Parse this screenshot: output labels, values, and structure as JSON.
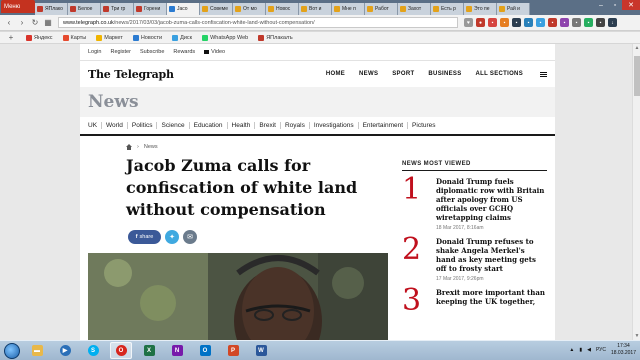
{
  "browser": {
    "menu_label": "Меню",
    "tabs": [
      {
        "label": "ЯПлако",
        "fav": "r"
      },
      {
        "label": "Белое",
        "fav": "r"
      },
      {
        "label": "Три гр",
        "fav": "r"
      },
      {
        "label": "Горени",
        "fav": "r"
      },
      {
        "label": "Jaco",
        "fav": "t",
        "active": true
      },
      {
        "label": "Совеме",
        "fav": "o"
      },
      {
        "label": "От мо",
        "fav": "o"
      },
      {
        "label": "Новос",
        "fav": "o"
      },
      {
        "label": "Вот и",
        "fav": "o"
      },
      {
        "label": "Мне п",
        "fav": "o"
      },
      {
        "label": "Работ",
        "fav": "o"
      },
      {
        "label": "Захот",
        "fav": "o"
      },
      {
        "label": "Есть р",
        "fav": "o"
      },
      {
        "label": "Это пе",
        "fav": "o"
      },
      {
        "label": "Рай и",
        "fav": "o"
      }
    ],
    "url_host": "www.telegraph.co.uk",
    "url_path": "/news/2017/03/03/jacob-zuma-calls-confiscation-white-land-without-compensation/",
    "bookmarks": [
      {
        "label": "Яндекс",
        "color": "#d9342b"
      },
      {
        "label": "Карты",
        "color": "#e64a2e"
      },
      {
        "label": "Маркет",
        "color": "#f0b400"
      },
      {
        "label": "Новости",
        "color": "#2b7bd1"
      },
      {
        "label": "Диск",
        "color": "#3aa0e0"
      },
      {
        "label": "WhatsApp Web",
        "color": "#25d366"
      },
      {
        "label": "ЯПлакалъ",
        "color": "#c0392b"
      }
    ]
  },
  "site": {
    "util_links": [
      "Login",
      "Register",
      "Subscribe",
      "Rewards"
    ],
    "video_label": "Video",
    "logo": "The Telegraph",
    "nav": [
      "HOME",
      "NEWS",
      "SPORT",
      "BUSINESS",
      "ALL SECTIONS"
    ],
    "section_title": "News",
    "subnav": [
      "UK",
      "World",
      "Politics",
      "Science",
      "Education",
      "Health",
      "Brexit",
      "Royals",
      "Investigations",
      "Entertainment",
      "Pictures"
    ],
    "breadcrumb": "News"
  },
  "article": {
    "headline_lines": [
      "Jacob Zuma calls for",
      "confiscation of white land",
      "without compensation"
    ],
    "share_label": "share"
  },
  "most_viewed": {
    "title": "NEWS MOST VIEWED",
    "items": [
      {
        "num": "1",
        "headline": "Donald Trump fuels diplomatic row with Britain after apology from US officials over GCHQ wiretapping claims",
        "date": "18 Mar 2017, 8:16am"
      },
      {
        "num": "2",
        "headline": "Donald Trump refuses to shake Angela Merkel's hand as key meeting gets off to frosty start",
        "date": "17 Mar 2017, 9:26pm"
      },
      {
        "num": "3",
        "headline": "Brexit more important than keeping the UK together,",
        "date": ""
      }
    ]
  },
  "taskbar": {
    "time": "17:34",
    "date": "18.03.2017",
    "lang": "РУС"
  }
}
